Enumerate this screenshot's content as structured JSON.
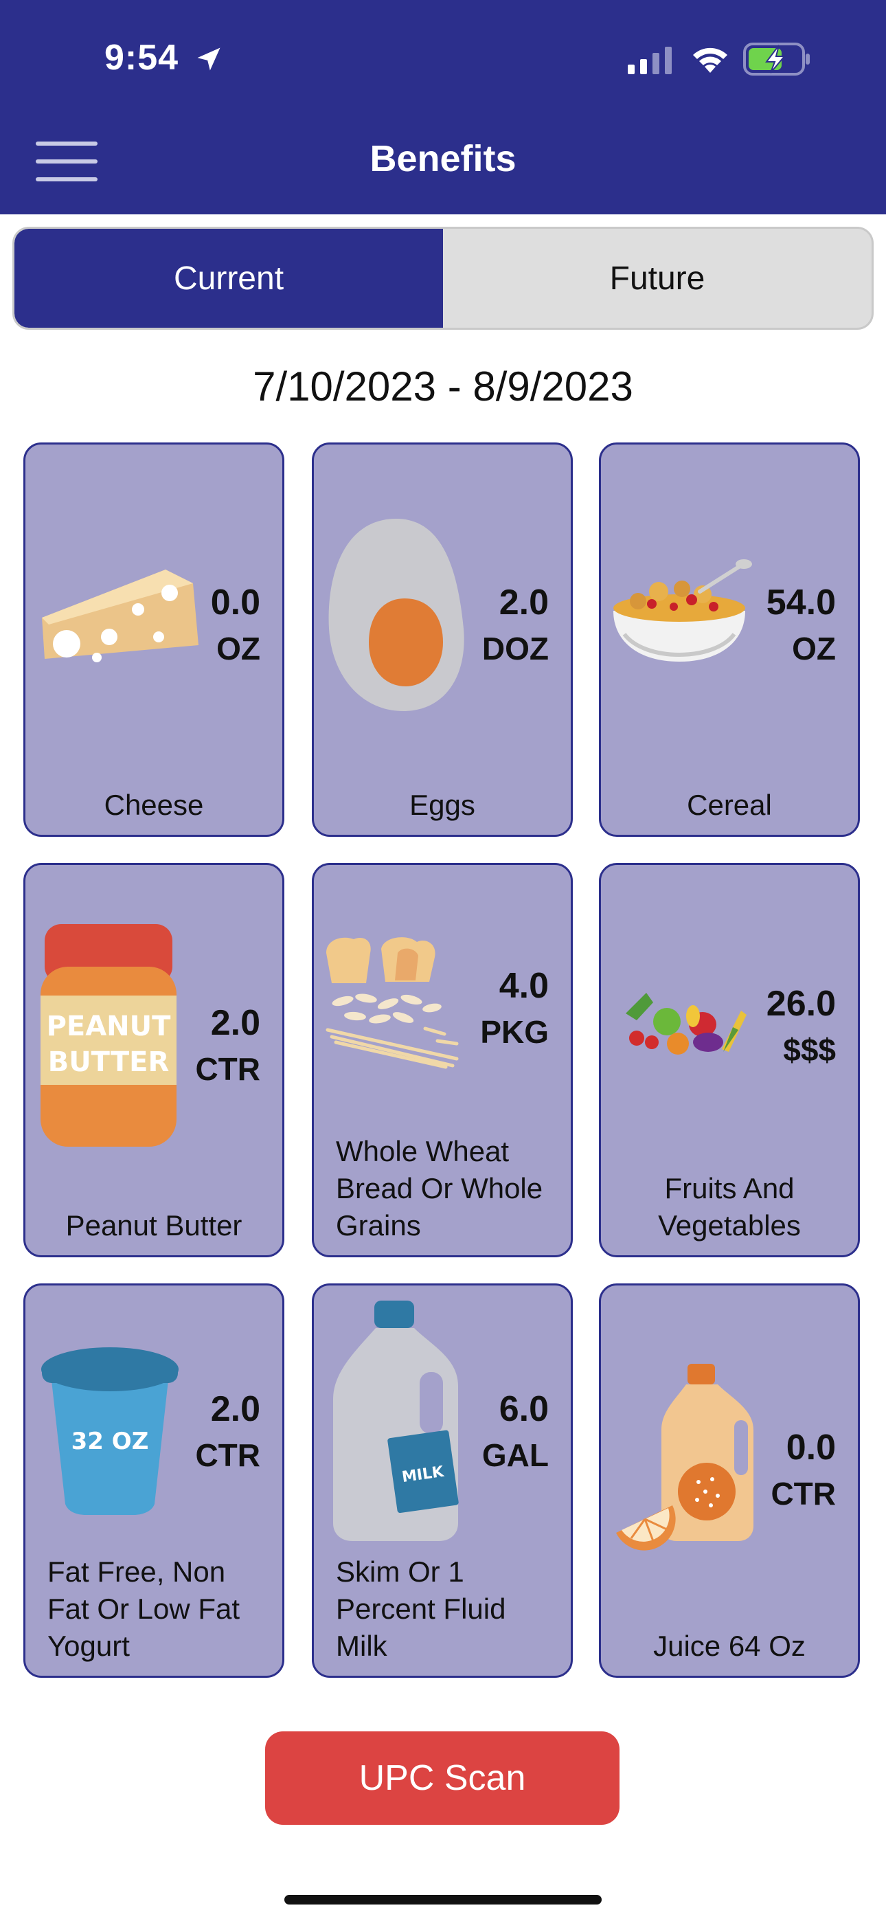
{
  "status_bar": {
    "time": "9:54"
  },
  "header": {
    "title": "Benefits"
  },
  "tabs": {
    "current": "Current",
    "future": "Future"
  },
  "date_range": "7/10/2023 - 8/9/2023",
  "benefits": [
    {
      "amount": "0.0",
      "unit": "OZ",
      "label": "Cheese",
      "icon": "cheese-icon"
    },
    {
      "amount": "2.0",
      "unit": "DOZ",
      "label": "Eggs",
      "icon": "egg-icon"
    },
    {
      "amount": "54.0",
      "unit": "OZ",
      "label": "Cereal",
      "icon": "cereal-icon"
    },
    {
      "amount": "2.0",
      "unit": "CTR",
      "label": "Peanut Butter",
      "icon": "peanut-butter-icon",
      "jar_text_1": "PEANUT",
      "jar_text_2": "BUTTER"
    },
    {
      "amount": "4.0",
      "unit": "PKG",
      "label_lines": [
        "Whole Wheat",
        "Bread Or Whole",
        "Grains"
      ],
      "icon": "bread-grains-icon"
    },
    {
      "amount": "26.0",
      "unit": "$$$",
      "label_lines": [
        "Fruits And",
        "Vegetables"
      ],
      "icon": "fruits-vegetables-icon"
    },
    {
      "amount": "2.0",
      "unit": "CTR",
      "label_lines": [
        "Fat Free, Non",
        "Fat Or Low Fat",
        "Yogurt"
      ],
      "icon": "yogurt-icon",
      "cup_text": "32 OZ"
    },
    {
      "amount": "6.0",
      "unit": "GAL",
      "label_lines": [
        "Skim Or 1",
        "Percent Fluid",
        "Milk"
      ],
      "icon": "milk-jug-icon",
      "jug_text": "MILK"
    },
    {
      "amount": "0.0",
      "unit": "CTR",
      "label": "Juice 64 Oz",
      "icon": "juice-icon"
    }
  ],
  "actions": {
    "upc_scan": "UPC Scan"
  },
  "colors": {
    "header": "#2c2f8c",
    "tile": "#a4a1cb",
    "button": "#dc4442"
  }
}
